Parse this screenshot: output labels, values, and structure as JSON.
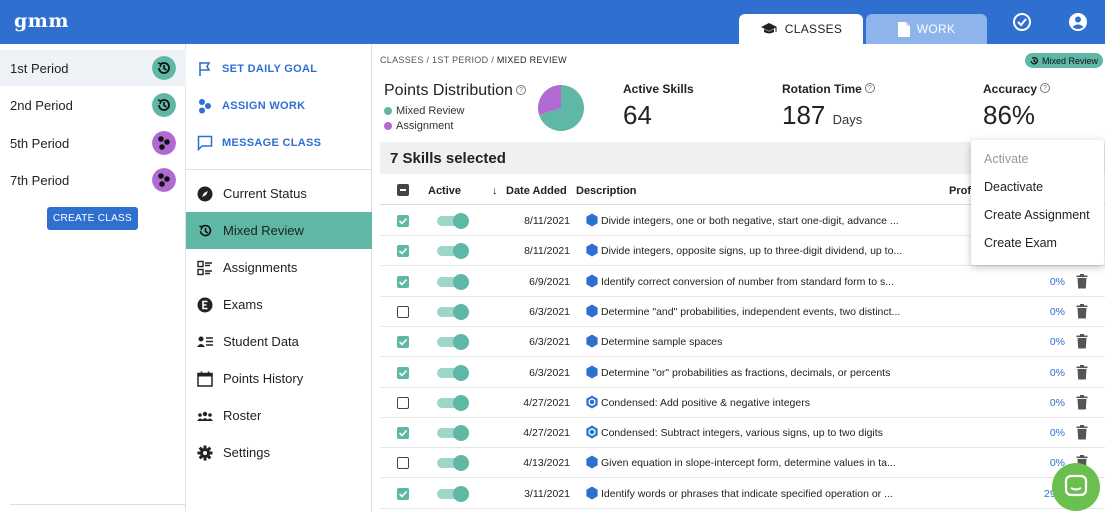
{
  "header": {
    "logo": "gmm",
    "tabs": [
      {
        "label": "CLASSES",
        "active": true
      },
      {
        "label": "WORK",
        "active": false
      }
    ]
  },
  "classes": {
    "items": [
      {
        "label": "1st Period",
        "selected": true,
        "icon": "history-icon",
        "color": "#5fb8a6"
      },
      {
        "label": "2nd Period",
        "selected": false,
        "icon": "history-icon",
        "color": "#5fb8a6"
      },
      {
        "label": "5th Period",
        "selected": false,
        "icon": "assignment-icon",
        "color": "#b06ad2"
      },
      {
        "label": "7th Period",
        "selected": false,
        "icon": "assignment-icon",
        "color": "#b06ad2"
      }
    ],
    "create_label": "CREATE CLASS"
  },
  "nav": {
    "actions": [
      {
        "label": "SET DAILY GOAL",
        "icon": "flag-icon"
      },
      {
        "label": "ASSIGN WORK",
        "icon": "assign-icon"
      },
      {
        "label": "MESSAGE CLASS",
        "icon": "message-icon"
      }
    ],
    "items": [
      {
        "label": "Current Status",
        "icon": "compass-icon"
      },
      {
        "label": "Mixed Review",
        "icon": "history-icon",
        "active": true
      },
      {
        "label": "Assignments",
        "icon": "list-icon"
      },
      {
        "label": "Exams",
        "icon": "exam-icon"
      },
      {
        "label": "Student Data",
        "icon": "student-data-icon"
      },
      {
        "label": "Points History",
        "icon": "calendar-icon"
      },
      {
        "label": "Roster",
        "icon": "people-icon"
      },
      {
        "label": "Settings",
        "icon": "gear-icon"
      }
    ]
  },
  "main": {
    "breadcrumb": [
      "CLASSES",
      "1ST PERIOD",
      "MIXED REVIEW"
    ],
    "badge": "Mixed Review",
    "points": {
      "title": "Points Distribution",
      "legend": [
        {
          "label": "Mixed Review",
          "color": "#5fb8a6",
          "share": 0.7
        },
        {
          "label": "Assignment",
          "color": "#b06ad2",
          "share": 0.3
        }
      ]
    },
    "stats": [
      {
        "label": "Active Skills",
        "value": "64",
        "unit": "",
        "help": false
      },
      {
        "label": "Rotation Time",
        "value": "187",
        "unit": "Days",
        "help": true
      },
      {
        "label": "Accuracy",
        "value": "86%",
        "unit": "",
        "help": true
      }
    ],
    "selected_text": "7 Skills selected",
    "columns": {
      "active": "Active",
      "date": "Date Added",
      "desc": "Description",
      "prof": "Prof"
    },
    "rows": [
      {
        "checked": true,
        "date": "8/11/2021",
        "desc": "Divide integers, one or both negative, start one-digit, advance ...",
        "prof": "",
        "hex": "solid"
      },
      {
        "checked": true,
        "date": "8/11/2021",
        "desc": "Divide integers, opposite signs, up to three-digit dividend, up to...",
        "prof": "",
        "hex": "solid"
      },
      {
        "checked": true,
        "date": "6/9/2021",
        "desc": "Identify correct conversion of number from standard form to s...",
        "prof": "0%",
        "hex": "solid"
      },
      {
        "checked": false,
        "date": "6/3/2021",
        "desc": "Determine \"and\" probabilities, independent events, two distinct...",
        "prof": "0%",
        "hex": "solid"
      },
      {
        "checked": true,
        "date": "6/3/2021",
        "desc": "Determine sample spaces",
        "prof": "0%",
        "hex": "solid"
      },
      {
        "checked": true,
        "date": "6/3/2021",
        "desc": "Determine \"or\" probabilities as fractions, decimals, or percents",
        "prof": "0%",
        "hex": "solid"
      },
      {
        "checked": false,
        "date": "4/27/2021",
        "desc": "Condensed: Add positive & negative integers",
        "prof": "0%",
        "hex": "ring"
      },
      {
        "checked": true,
        "date": "4/27/2021",
        "desc": "Condensed: Subtract integers, various signs, up to two digits",
        "prof": "0%",
        "hex": "ring"
      },
      {
        "checked": false,
        "date": "4/13/2021",
        "desc": "Given equation in slope-intercept form, determine values in ta...",
        "prof": "0%",
        "hex": "solid"
      },
      {
        "checked": true,
        "date": "3/11/2021",
        "desc": "Identify words or phrases that indicate specified operation or ...",
        "prof": "29%",
        "hex": "solid"
      }
    ]
  },
  "dropdown": {
    "items": [
      {
        "label": "Activate",
        "disabled": true
      },
      {
        "label": "Deactivate",
        "disabled": false
      },
      {
        "label": "Create Assignment",
        "disabled": false
      },
      {
        "label": "Create Exam",
        "disabled": false
      }
    ]
  }
}
